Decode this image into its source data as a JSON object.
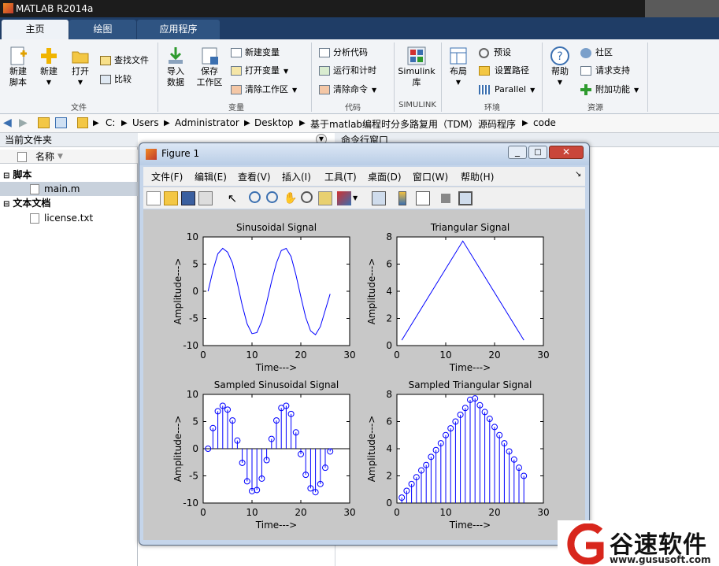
{
  "window": {
    "title": "MATLAB R2014a"
  },
  "tabs": [
    "主页",
    "绘图",
    "应用程序"
  ],
  "ribbon": {
    "new_script": "新建\n脚本",
    "new": "新建",
    "open": "打开",
    "find_files": "查找文件",
    "compare": "比较",
    "import_data": "导入\n数据",
    "save_workspace": "保存\n工作区",
    "new_variable": "新建变量",
    "open_variable": "打开变量",
    "clear_workspace": "清除工作区",
    "analyze_code": "分析代码",
    "run_and_time": "运行和计时",
    "clear_commands": "清除命令",
    "simulink_library": "Simulink\n库",
    "layout": "布局",
    "preferences": "预设",
    "set_path": "设置路径",
    "parallel": "Parallel",
    "help": "帮助",
    "community": "社区",
    "request_support": "请求支持",
    "addons": "附加功能",
    "sections": {
      "file": "文件",
      "variable": "变量",
      "code": "代码",
      "simulink": "SIMULINK",
      "environment": "环境",
      "resources": "资源"
    }
  },
  "path": [
    "C:",
    "Users",
    "Administrator",
    "Desktop",
    "基于matlab编程时分多路复用（TDM）源码程序",
    "code"
  ],
  "current_folder": {
    "title": "当前文件夹",
    "column": "名称",
    "groups": [
      {
        "name": "脚本",
        "files": [
          "main.m"
        ]
      },
      {
        "name": "文本文档",
        "files": [
          "license.txt"
        ]
      }
    ]
  },
  "command_window": {
    "title": "命令行窗口"
  },
  "figure": {
    "title": "Figure 1",
    "menus": [
      "文件(F)",
      "编辑(E)",
      "查看(V)",
      "插入(I)",
      "工具(T)",
      "桌面(D)",
      "窗口(W)",
      "帮助(H)"
    ]
  },
  "chart_data": [
    {
      "type": "line",
      "title": "Sinusoidal Signal",
      "xlabel": "Time--->",
      "ylabel": "Amplitude--->",
      "xlim": [
        0,
        30
      ],
      "ylim": [
        -10,
        10
      ],
      "xticks": [
        0,
        10,
        20,
        30
      ],
      "yticks": [
        -10,
        -5,
        0,
        5,
        10
      ],
      "grid": false,
      "color": "#0000ff",
      "x": [
        1,
        2,
        3,
        4,
        5,
        6,
        7,
        8,
        9,
        10,
        11,
        12,
        13,
        14,
        15,
        16,
        17,
        18,
        19,
        20,
        21,
        22,
        23,
        24,
        25,
        26
      ],
      "y": [
        0,
        3.8,
        6.9,
        7.9,
        7.2,
        5.2,
        1.5,
        -2.6,
        -6.0,
        -7.8,
        -7.6,
        -5.5,
        -2.1,
        1.8,
        5.2,
        7.5,
        7.9,
        6.4,
        3.0,
        -1.0,
        -4.8,
        -7.3,
        -8.0,
        -6.5,
        -3.5,
        -0.5
      ]
    },
    {
      "type": "line",
      "title": "Triangular Signal",
      "xlabel": "Time--->",
      "ylabel": "Amplitude--->",
      "xlim": [
        0,
        30
      ],
      "ylim": [
        0,
        8
      ],
      "xticks": [
        0,
        10,
        20,
        30
      ],
      "yticks": [
        0,
        2,
        4,
        6,
        8
      ],
      "grid": false,
      "color": "#0000ff",
      "x": [
        1,
        13.5,
        26
      ],
      "y": [
        0.4,
        7.7,
        0.4
      ]
    },
    {
      "type": "scatter",
      "title": "Sampled Sinusoidal Signal",
      "xlabel": "Time--->",
      "ylabel": "Amplitude--->",
      "xlim": [
        0,
        30
      ],
      "ylim": [
        -10,
        10
      ],
      "xticks": [
        0,
        10,
        20,
        30
      ],
      "yticks": [
        -10,
        -5,
        0,
        5,
        10
      ],
      "grid": false,
      "color": "#0000ff",
      "marker": "stem",
      "x": [
        1,
        2,
        3,
        4,
        5,
        6,
        7,
        8,
        9,
        10,
        11,
        12,
        13,
        14,
        15,
        16,
        17,
        18,
        19,
        20,
        21,
        22,
        23,
        24,
        25,
        26
      ],
      "y": [
        0,
        3.8,
        6.9,
        7.9,
        7.2,
        5.2,
        1.5,
        -2.6,
        -6.0,
        -7.8,
        -7.6,
        -5.5,
        -2.1,
        1.8,
        5.2,
        7.5,
        7.9,
        6.4,
        3.0,
        -1.0,
        -4.8,
        -7.3,
        -8.0,
        -6.5,
        -3.5,
        -0.5
      ]
    },
    {
      "type": "scatter",
      "title": "Sampled Triangular Signal",
      "xlabel": "Time--->",
      "ylabel": "Amplitude--->",
      "xlim": [
        0,
        30
      ],
      "ylim": [
        0,
        8
      ],
      "xticks": [
        0,
        10,
        20,
        30
      ],
      "yticks": [
        0,
        2,
        4,
        6,
        8
      ],
      "grid": false,
      "color": "#0000ff",
      "marker": "stem",
      "x": [
        1,
        2,
        3,
        4,
        5,
        6,
        7,
        8,
        9,
        10,
        11,
        12,
        13,
        14,
        15,
        16,
        17,
        18,
        19,
        20,
        21,
        22,
        23,
        24,
        25,
        26
      ],
      "y": [
        0.4,
        0.9,
        1.4,
        1.9,
        2.4,
        2.8,
        3.4,
        3.9,
        4.4,
        5.0,
        5.5,
        6.0,
        6.5,
        7.0,
        7.6,
        7.7,
        7.2,
        6.7,
        6.2,
        5.6,
        5.0,
        4.4,
        3.8,
        3.2,
        2.6,
        2.0
      ]
    }
  ],
  "watermark": {
    "brand": "谷速软件",
    "url": "www.gususoft.com"
  }
}
